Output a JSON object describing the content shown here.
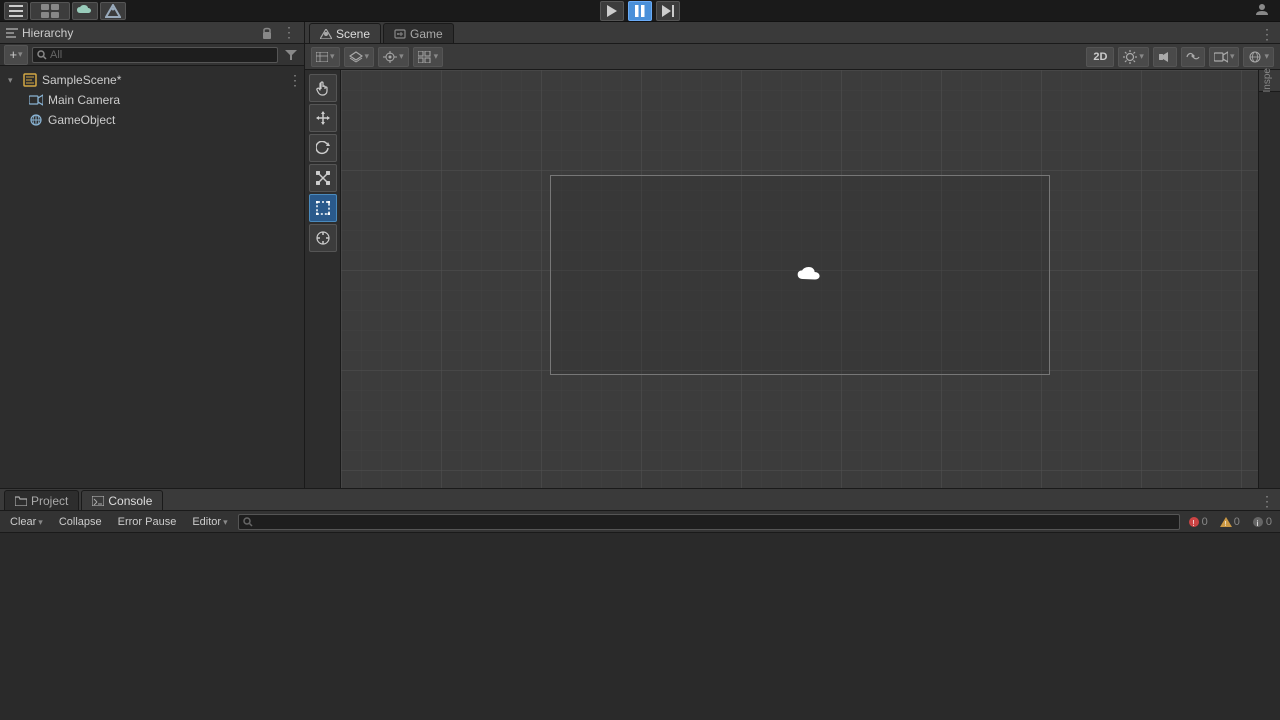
{
  "topbar": {
    "play_label": "▶",
    "pause_label": "⏸",
    "step_label": "⏭",
    "cloud_label": "☁",
    "collab_label": "⬡"
  },
  "hierarchy": {
    "title": "Hierarchy",
    "search_placeholder": "All",
    "scene_name": "SampleScene*",
    "items": [
      {
        "label": "Main Camera",
        "type": "camera",
        "depth": 1
      },
      {
        "label": "GameObject",
        "type": "object",
        "depth": 1
      }
    ]
  },
  "scene": {
    "tab_scene": "Scene",
    "tab_game": "Game",
    "btn_2d": "2D",
    "toolbar": {
      "shading": "☰",
      "layers": "⊞",
      "pivot": "◎",
      "global": "⊕",
      "snap": "⋮"
    }
  },
  "tools": {
    "hand": "✋",
    "move": "✥",
    "rotate": "↺",
    "scale": "⤡",
    "rect": "⊡",
    "combined": "⊕"
  },
  "inspector": {
    "title": "Inspe"
  },
  "console": {
    "tab_project": "Project",
    "tab_console": "Console",
    "btn_clear": "Clear",
    "btn_collapse": "Collapse",
    "btn_error_pause": "Error Pause",
    "btn_editor": "Editor",
    "search_placeholder": "",
    "error_count": "0",
    "warning_count": "0",
    "info_count": "0",
    "error_icon": "🔴",
    "warning_icon": "⚠",
    "info_icon": "ℹ"
  },
  "colors": {
    "accent_blue": "#2a5a8c",
    "bg_dark": "#2d2d2d",
    "bg_mid": "#3a3a3a",
    "bg_main": "#3c3c3c",
    "border": "#1a1a1a",
    "text_normal": "#d4d4d4",
    "text_dim": "#888888"
  }
}
